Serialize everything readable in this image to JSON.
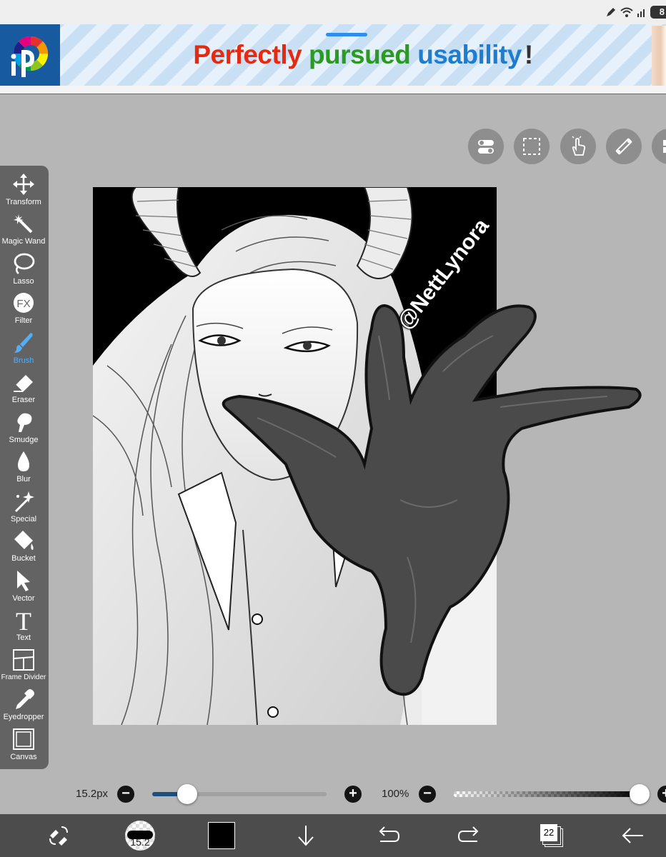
{
  "status_bar": {
    "battery": "8"
  },
  "ad": {
    "title_parts": [
      "Perfectly",
      " pursued",
      " usability",
      "!"
    ],
    "colors": {
      "perfectly": "#e52a12",
      "pursued": "#2a9a23",
      "usability": "#1f7dd0",
      "exclaim": "#333333"
    },
    "logo_text": "iP"
  },
  "top_toolbar": [
    {
      "name": "toggle-icon"
    },
    {
      "name": "selection-icon"
    },
    {
      "name": "hand-touch-icon"
    },
    {
      "name": "ruler-icon"
    },
    {
      "name": "material-icon"
    }
  ],
  "tools": [
    {
      "id": "transform",
      "label": "Transform",
      "icon": "move-arrows-icon"
    },
    {
      "id": "magic-wand",
      "label": "Magic Wand",
      "icon": "magic-wand-icon"
    },
    {
      "id": "lasso",
      "label": "Lasso",
      "icon": "lasso-icon"
    },
    {
      "id": "filter",
      "label": "Filter",
      "icon": "fx-icon"
    },
    {
      "id": "brush",
      "label": "Brush",
      "icon": "brush-icon",
      "active": true
    },
    {
      "id": "eraser",
      "label": "Eraser",
      "icon": "eraser-icon"
    },
    {
      "id": "smudge",
      "label": "Smudge",
      "icon": "smudge-icon"
    },
    {
      "id": "blur",
      "label": "Blur",
      "icon": "drop-icon"
    },
    {
      "id": "special",
      "label": "Special",
      "icon": "sparkle-pen-icon"
    },
    {
      "id": "bucket",
      "label": "Bucket",
      "icon": "bucket-icon"
    },
    {
      "id": "vector",
      "label": "Vector",
      "icon": "cursor-arrow-icon"
    },
    {
      "id": "text",
      "label": "Text",
      "icon": "text-t-icon"
    },
    {
      "id": "frame-divider",
      "label": "Frame Divider",
      "icon": "frame-divider-icon"
    },
    {
      "id": "eyedropper",
      "label": "Eyedropper",
      "icon": "eyedropper-icon"
    },
    {
      "id": "canvas",
      "label": "Canvas",
      "icon": "canvas-icon"
    }
  ],
  "brush_size": {
    "label": "15.2px",
    "fraction": 0.2
  },
  "opacity": {
    "label": "100%",
    "fraction": 1.0
  },
  "canvas": {
    "watermark": "@NettLynora"
  },
  "bottom_bar": {
    "brush_size_badge": "15.2",
    "layer_count": "22",
    "primary_color": "#000000"
  },
  "colors": {
    "accent": "#53aef7",
    "toolbar_bg": "#636363",
    "bottom_bg": "#4c4c4c",
    "canvas_bg": "#b6b6b6"
  }
}
